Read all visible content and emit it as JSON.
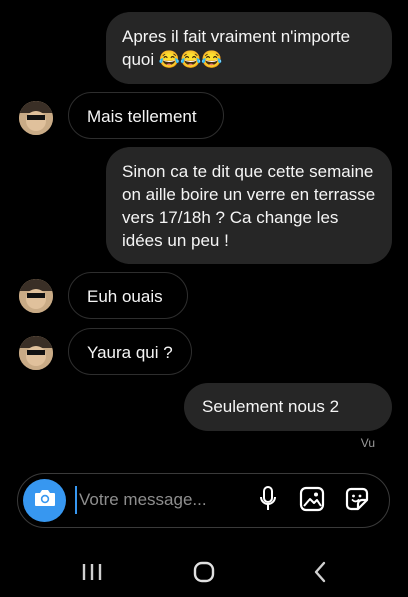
{
  "conversation": {
    "messages": [
      {
        "side": "sent",
        "text": "Apres il fait vraiment n'importe quoi 😂😂😂"
      },
      {
        "side": "received",
        "text": "Mais tellement"
      },
      {
        "side": "sent",
        "text": "Sinon ca te dit que cette semaine on aille boire un verre en terrasse vers 17/18h ? Ca change les idées un peu !"
      },
      {
        "side": "received",
        "text": "Euh ouais"
      },
      {
        "side": "received",
        "text": "Yaura qui ?"
      },
      {
        "side": "sent",
        "text": "Seulement nous 2"
      }
    ],
    "seen_status": "Vu"
  },
  "composer": {
    "placeholder": "Votre message...",
    "value": "",
    "icons": [
      "camera-icon",
      "microphone-icon",
      "gallery-icon",
      "sticker-icon"
    ],
    "accent_color": "#3797f0"
  },
  "system_nav": {
    "icons": [
      "recent-apps-icon",
      "home-icon",
      "back-icon"
    ]
  },
  "colors": {
    "background": "#000000",
    "sent_bubble": "#262626",
    "received_border": "#2e2e2e",
    "text": "#f5f5f5",
    "muted": "#9a9a9a"
  }
}
